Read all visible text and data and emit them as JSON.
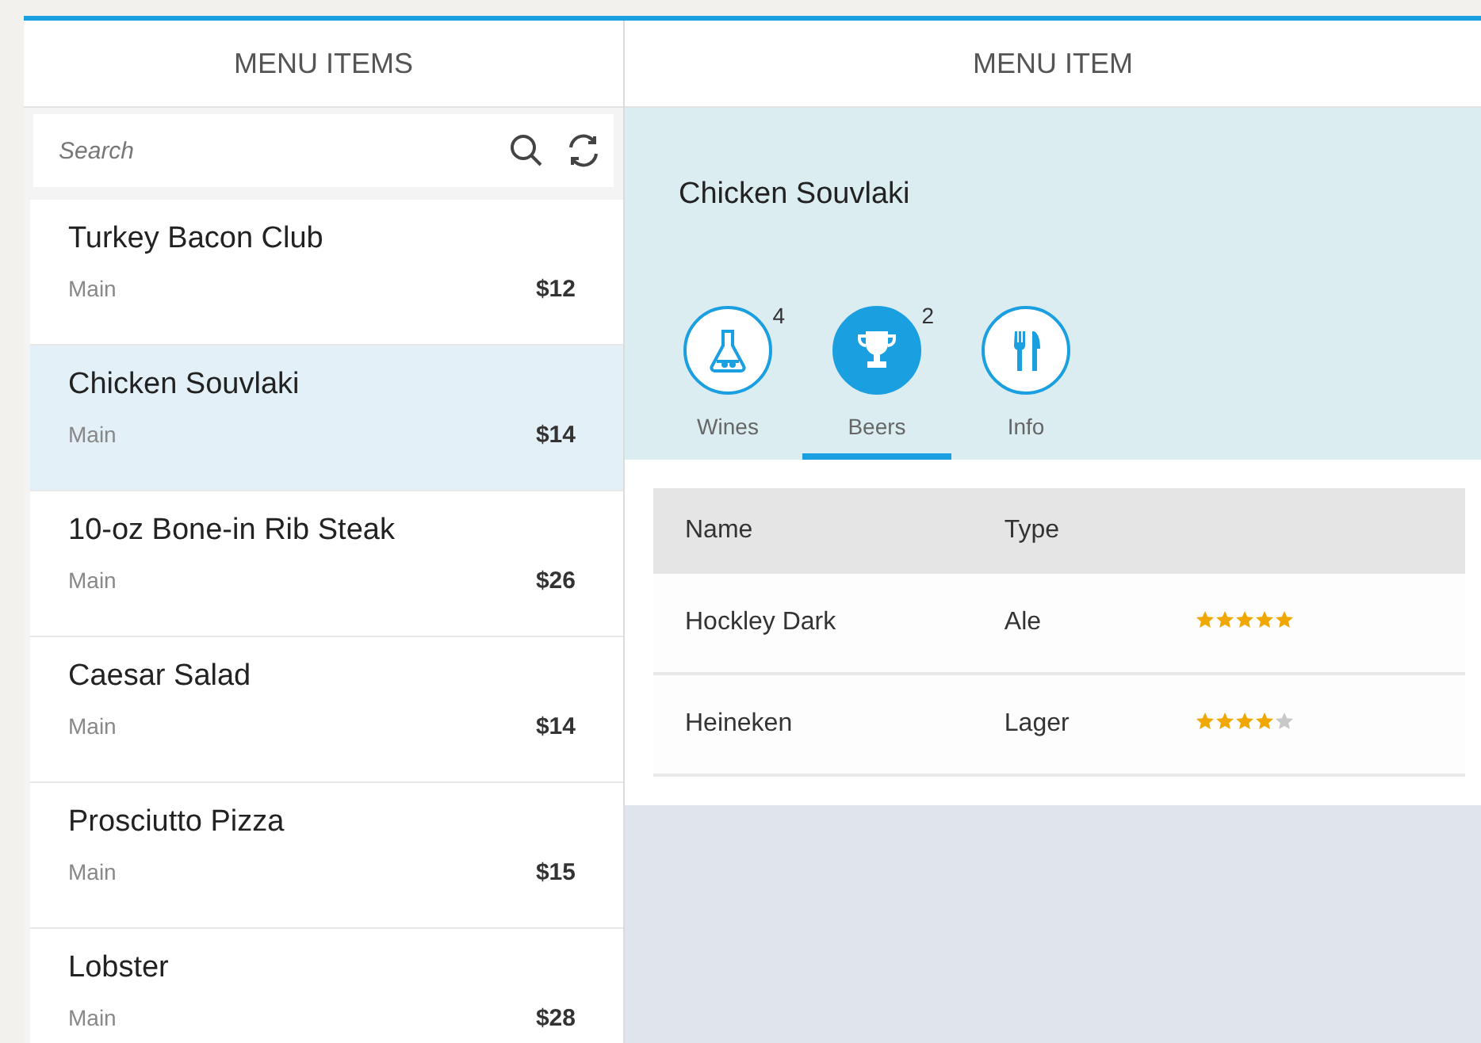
{
  "list_panel": {
    "title": "MENU ITEMS",
    "search": {
      "placeholder": "Search"
    },
    "items": [
      {
        "name": "Turkey Bacon Club",
        "category": "Main",
        "price": "$12",
        "selected": false
      },
      {
        "name": "Chicken Souvlaki",
        "category": "Main",
        "price": "$14",
        "selected": true
      },
      {
        "name": "10-oz Bone-in Rib Steak",
        "category": "Main",
        "price": "$26",
        "selected": false
      },
      {
        "name": "Caesar Salad",
        "category": "Main",
        "price": "$14",
        "selected": false
      },
      {
        "name": "Prosciutto Pizza",
        "category": "Main",
        "price": "$15",
        "selected": false
      },
      {
        "name": "Lobster",
        "category": "Main",
        "price": "$28",
        "selected": false
      }
    ]
  },
  "detail_panel": {
    "title": "MENU ITEM",
    "item_title": "Chicken Souvlaki",
    "tabs": [
      {
        "kind": "flask",
        "label": "Wines",
        "count": "4",
        "selected": false
      },
      {
        "kind": "trophy",
        "label": "Beers",
        "count": "2",
        "selected": true
      },
      {
        "kind": "cutlery",
        "label": "Info",
        "selected": false
      }
    ],
    "table": {
      "columns": [
        "Name",
        "Type"
      ],
      "rows": [
        {
          "name": "Hockley Dark",
          "type": "Ale",
          "stars": 5
        },
        {
          "name": "Heineken",
          "type": "Lager",
          "stars": 4
        }
      ]
    }
  }
}
